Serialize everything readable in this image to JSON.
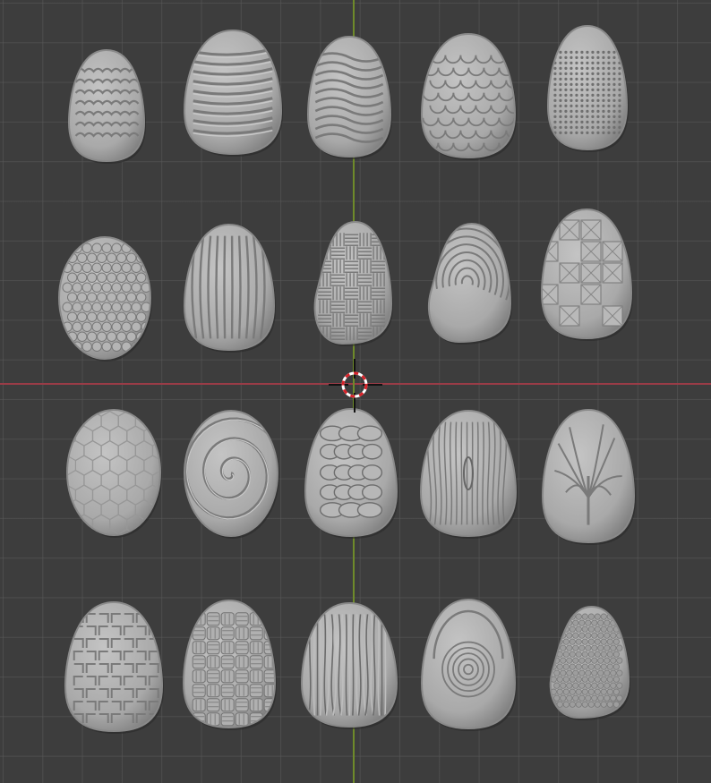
{
  "viewport": {
    "background": "#3d3d3d",
    "grid_color": "#5a5a5a",
    "x_axis_color": "#9a3c47",
    "y_axis_color": "#6e8a2a",
    "stone_color": "#a9a9a9"
  },
  "stones": [
    {
      "id": "wavy-lines",
      "pattern": "wavy"
    },
    {
      "id": "horizontal-ridges",
      "pattern": "ridges"
    },
    {
      "id": "wavy-ridges",
      "pattern": "wavy-ridges"
    },
    {
      "id": "fish-scales",
      "pattern": "scales"
    },
    {
      "id": "dot-grid",
      "pattern": "dots"
    },
    {
      "id": "bubbles",
      "pattern": "bubbles"
    },
    {
      "id": "vertical-ridges",
      "pattern": "vstripes"
    },
    {
      "id": "basket-weave-small",
      "pattern": "basket"
    },
    {
      "id": "fingerprint",
      "pattern": "fingerprint"
    },
    {
      "id": "pyramid-studs",
      "pattern": "pyramids"
    },
    {
      "id": "hexagons",
      "pattern": "hex"
    },
    {
      "id": "spiral",
      "pattern": "spiral"
    },
    {
      "id": "pebbles",
      "pattern": "pebbles"
    },
    {
      "id": "wood-grain",
      "pattern": "wood"
    },
    {
      "id": "branches",
      "pattern": "tree"
    },
    {
      "id": "maze",
      "pattern": "maze"
    },
    {
      "id": "weave",
      "pattern": "weave"
    },
    {
      "id": "bark",
      "pattern": "bark"
    },
    {
      "id": "concentric-rings",
      "pattern": "rings"
    },
    {
      "id": "hammered",
      "pattern": "hammered"
    }
  ]
}
